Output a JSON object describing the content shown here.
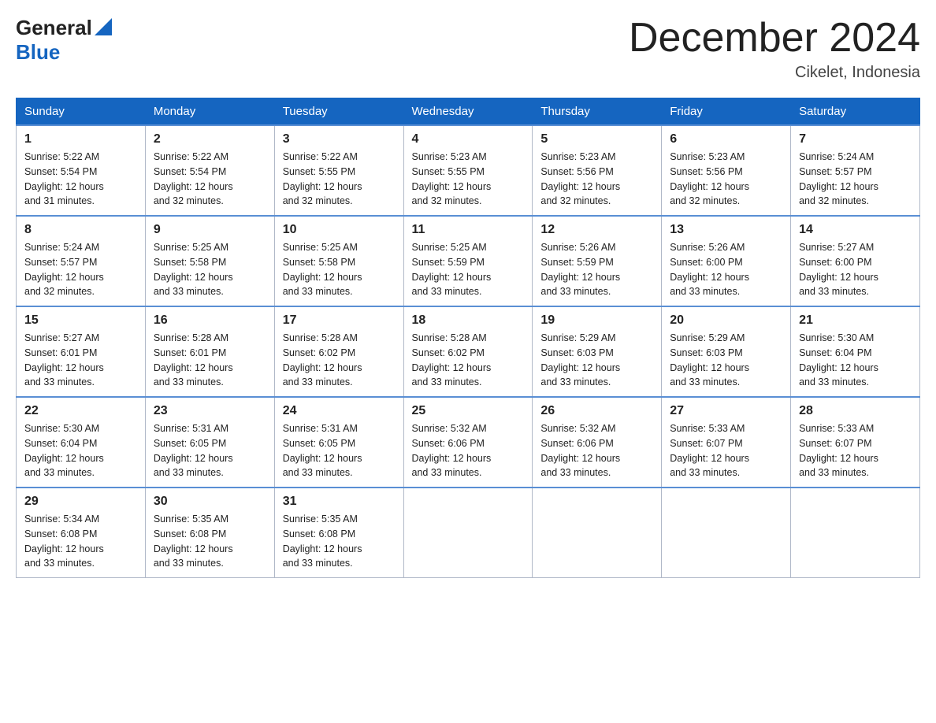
{
  "header": {
    "logo_general": "General",
    "logo_blue": "Blue",
    "month_title": "December 2024",
    "location": "Cikelet, Indonesia"
  },
  "days_of_week": [
    "Sunday",
    "Monday",
    "Tuesday",
    "Wednesday",
    "Thursday",
    "Friday",
    "Saturday"
  ],
  "weeks": [
    [
      {
        "day": "1",
        "sunrise": "5:22 AM",
        "sunset": "5:54 PM",
        "daylight": "12 hours and 31 minutes."
      },
      {
        "day": "2",
        "sunrise": "5:22 AM",
        "sunset": "5:54 PM",
        "daylight": "12 hours and 32 minutes."
      },
      {
        "day": "3",
        "sunrise": "5:22 AM",
        "sunset": "5:55 PM",
        "daylight": "12 hours and 32 minutes."
      },
      {
        "day": "4",
        "sunrise": "5:23 AM",
        "sunset": "5:55 PM",
        "daylight": "12 hours and 32 minutes."
      },
      {
        "day": "5",
        "sunrise": "5:23 AM",
        "sunset": "5:56 PM",
        "daylight": "12 hours and 32 minutes."
      },
      {
        "day": "6",
        "sunrise": "5:23 AM",
        "sunset": "5:56 PM",
        "daylight": "12 hours and 32 minutes."
      },
      {
        "day": "7",
        "sunrise": "5:24 AM",
        "sunset": "5:57 PM",
        "daylight": "12 hours and 32 minutes."
      }
    ],
    [
      {
        "day": "8",
        "sunrise": "5:24 AM",
        "sunset": "5:57 PM",
        "daylight": "12 hours and 32 minutes."
      },
      {
        "day": "9",
        "sunrise": "5:25 AM",
        "sunset": "5:58 PM",
        "daylight": "12 hours and 33 minutes."
      },
      {
        "day": "10",
        "sunrise": "5:25 AM",
        "sunset": "5:58 PM",
        "daylight": "12 hours and 33 minutes."
      },
      {
        "day": "11",
        "sunrise": "5:25 AM",
        "sunset": "5:59 PM",
        "daylight": "12 hours and 33 minutes."
      },
      {
        "day": "12",
        "sunrise": "5:26 AM",
        "sunset": "5:59 PM",
        "daylight": "12 hours and 33 minutes."
      },
      {
        "day": "13",
        "sunrise": "5:26 AM",
        "sunset": "6:00 PM",
        "daylight": "12 hours and 33 minutes."
      },
      {
        "day": "14",
        "sunrise": "5:27 AM",
        "sunset": "6:00 PM",
        "daylight": "12 hours and 33 minutes."
      }
    ],
    [
      {
        "day": "15",
        "sunrise": "5:27 AM",
        "sunset": "6:01 PM",
        "daylight": "12 hours and 33 minutes."
      },
      {
        "day": "16",
        "sunrise": "5:28 AM",
        "sunset": "6:01 PM",
        "daylight": "12 hours and 33 minutes."
      },
      {
        "day": "17",
        "sunrise": "5:28 AM",
        "sunset": "6:02 PM",
        "daylight": "12 hours and 33 minutes."
      },
      {
        "day": "18",
        "sunrise": "5:28 AM",
        "sunset": "6:02 PM",
        "daylight": "12 hours and 33 minutes."
      },
      {
        "day": "19",
        "sunrise": "5:29 AM",
        "sunset": "6:03 PM",
        "daylight": "12 hours and 33 minutes."
      },
      {
        "day": "20",
        "sunrise": "5:29 AM",
        "sunset": "6:03 PM",
        "daylight": "12 hours and 33 minutes."
      },
      {
        "day": "21",
        "sunrise": "5:30 AM",
        "sunset": "6:04 PM",
        "daylight": "12 hours and 33 minutes."
      }
    ],
    [
      {
        "day": "22",
        "sunrise": "5:30 AM",
        "sunset": "6:04 PM",
        "daylight": "12 hours and 33 minutes."
      },
      {
        "day": "23",
        "sunrise": "5:31 AM",
        "sunset": "6:05 PM",
        "daylight": "12 hours and 33 minutes."
      },
      {
        "day": "24",
        "sunrise": "5:31 AM",
        "sunset": "6:05 PM",
        "daylight": "12 hours and 33 minutes."
      },
      {
        "day": "25",
        "sunrise": "5:32 AM",
        "sunset": "6:06 PM",
        "daylight": "12 hours and 33 minutes."
      },
      {
        "day": "26",
        "sunrise": "5:32 AM",
        "sunset": "6:06 PM",
        "daylight": "12 hours and 33 minutes."
      },
      {
        "day": "27",
        "sunrise": "5:33 AM",
        "sunset": "6:07 PM",
        "daylight": "12 hours and 33 minutes."
      },
      {
        "day": "28",
        "sunrise": "5:33 AM",
        "sunset": "6:07 PM",
        "daylight": "12 hours and 33 minutes."
      }
    ],
    [
      {
        "day": "29",
        "sunrise": "5:34 AM",
        "sunset": "6:08 PM",
        "daylight": "12 hours and 33 minutes."
      },
      {
        "day": "30",
        "sunrise": "5:35 AM",
        "sunset": "6:08 PM",
        "daylight": "12 hours and 33 minutes."
      },
      {
        "day": "31",
        "sunrise": "5:35 AM",
        "sunset": "6:08 PM",
        "daylight": "12 hours and 33 minutes."
      },
      null,
      null,
      null,
      null
    ]
  ],
  "labels": {
    "sunrise": "Sunrise:",
    "sunset": "Sunset:",
    "daylight": "Daylight:"
  }
}
